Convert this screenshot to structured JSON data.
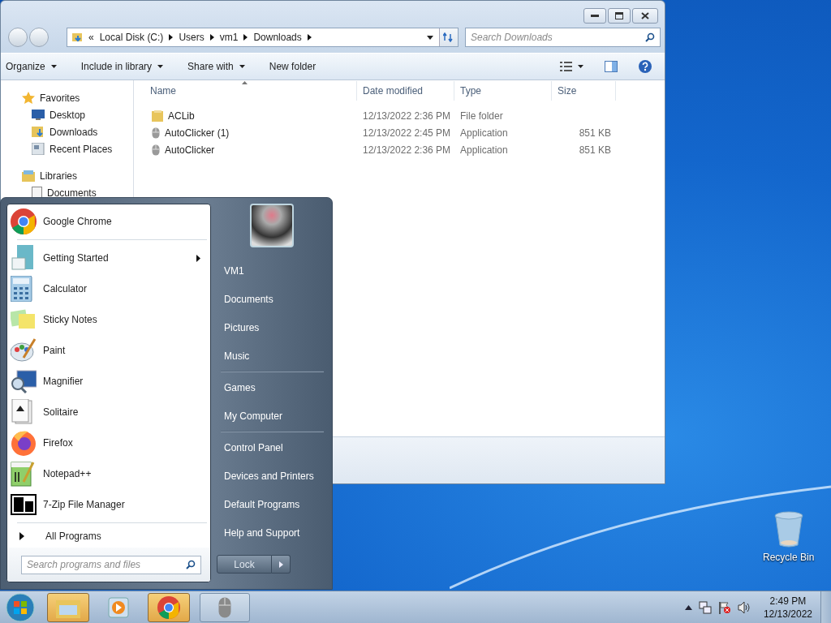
{
  "explorer": {
    "address": {
      "overflow": "«",
      "crumbs": [
        "Local Disk (C:)",
        "Users",
        "vm1",
        "Downloads"
      ]
    },
    "search": {
      "placeholder": "Search Downloads"
    },
    "toolbar": [
      {
        "label": "Organize",
        "dropdown": true
      },
      {
        "label": "Include in library",
        "dropdown": true
      },
      {
        "label": "Share with",
        "dropdown": true
      },
      {
        "label": "New folder",
        "dropdown": false
      }
    ],
    "nav": [
      {
        "label": "Favorites",
        "kind": "star",
        "children": [
          {
            "label": "Desktop",
            "kind": "desktop"
          },
          {
            "label": "Downloads",
            "kind": "downloads"
          },
          {
            "label": "Recent Places",
            "kind": "recent"
          }
        ]
      },
      {
        "label": "Libraries",
        "kind": "library",
        "children": [
          {
            "label": "Documents",
            "kind": "document"
          }
        ]
      }
    ],
    "columns": [
      {
        "label": "Name",
        "sorted": true
      },
      {
        "label": "Date modified",
        "sorted": false
      },
      {
        "label": "Type",
        "sorted": false
      },
      {
        "label": "Size",
        "sorted": false
      }
    ],
    "rows": [
      {
        "kind": "folder",
        "name": "ACLib",
        "date": "12/13/2022 2:36 PM",
        "type": "File folder"
      },
      {
        "kind": "app",
        "name": "AutoClicker (1)",
        "date": "12/13/2022 2:45 PM",
        "type": "Application",
        "size": "851 KB"
      },
      {
        "kind": "app",
        "name": "AutoClicker",
        "date": "12/13/2022 2:36 PM",
        "type": "Application",
        "size": "851 KB"
      }
    ]
  },
  "start_menu": {
    "pinned": [
      {
        "label": "Google Chrome",
        "kind": "chrome",
        "submenu": false
      }
    ],
    "recent": [
      {
        "label": "Getting Started",
        "kind": "started",
        "submenu": true
      },
      {
        "label": "Calculator",
        "kind": "calculator",
        "submenu": false
      },
      {
        "label": "Sticky Notes",
        "kind": "notes",
        "submenu": false
      },
      {
        "label": "Paint",
        "kind": "paint",
        "submenu": false
      },
      {
        "label": "Magnifier",
        "kind": "magnifier",
        "submenu": false
      },
      {
        "label": "Solitaire",
        "kind": "solitaire",
        "submenu": false
      },
      {
        "label": "Firefox",
        "kind": "firefox",
        "submenu": false
      },
      {
        "label": "Notepad++",
        "kind": "notepad",
        "submenu": false
      },
      {
        "label": "7-Zip File Manager",
        "kind": "zip",
        "submenu": false
      }
    ],
    "all_programs": "All Programs",
    "search": {
      "placeholder": "Search programs and files"
    },
    "place_groups": [
      [
        "VM1",
        "Documents",
        "Pictures",
        "Music"
      ],
      [
        "Games",
        "My Computer"
      ],
      [
        "Control Panel",
        "Devices and Printers",
        "Default Programs",
        "Help and Support"
      ]
    ],
    "lock_button": "Lock"
  },
  "taskbar": {
    "buttons": [
      {
        "kind": "explorer",
        "highlighted": true
      },
      {
        "kind": "media",
        "highlighted": false
      },
      {
        "kind": "chrome",
        "highlighted": true
      },
      {
        "kind": "mouse",
        "highlighted": false
      }
    ],
    "clock": {
      "time": "2:49 PM",
      "date": "12/13/2022"
    }
  },
  "desktop_icons": [
    {
      "label": "Recycle Bin"
    }
  ]
}
